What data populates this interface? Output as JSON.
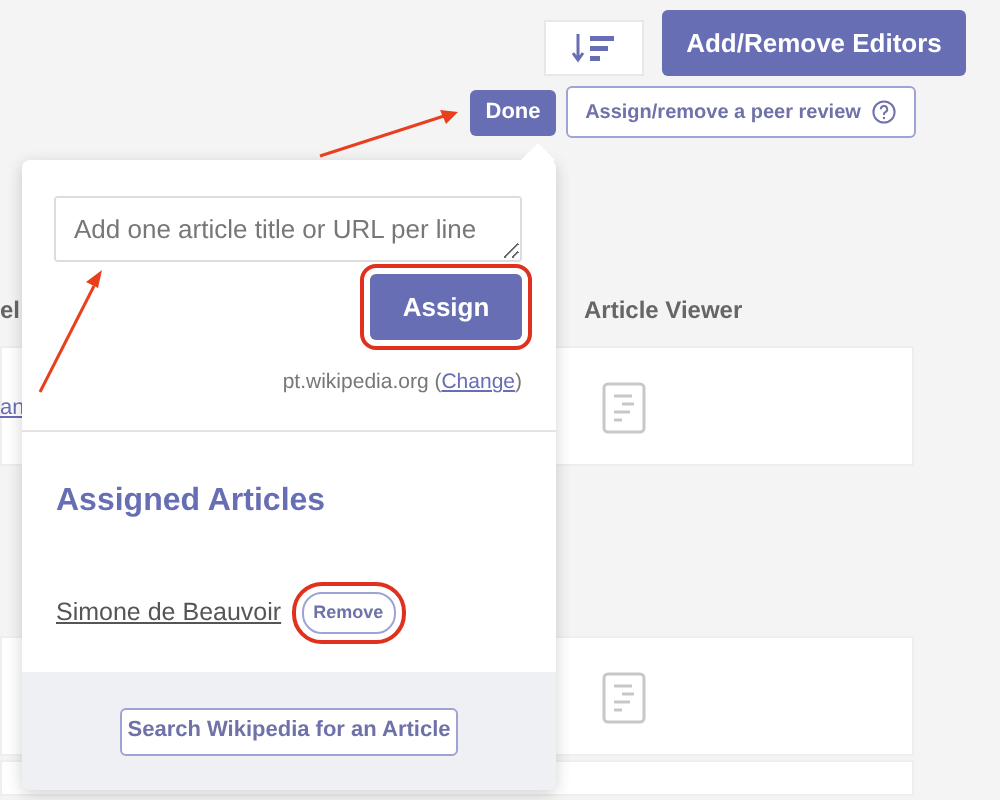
{
  "toolbar": {
    "editors_button": "Add/Remove Editors",
    "done_button": "Done",
    "peer_review_button": "Assign/remove a peer review"
  },
  "table": {
    "columns": [
      "el",
      "Article Viewer"
    ],
    "rows": [
      {
        "kind": "article",
        "link": "an"
      },
      {
        "kind": "article"
      },
      {
        "kind": "article"
      }
    ]
  },
  "popover": {
    "placeholder": "Add one article title or URL per line",
    "assign_button": {
      "label": "Assign",
      "highlighted": true
    },
    "wiki_note": {
      "prefix": "pt.wikipedia.org (",
      "link": "Change",
      "suffix": ")"
    },
    "heading": "Assigned Articles",
    "articles": [
      {
        "title": "Simone de Beauvoir",
        "remove_label": "Remove",
        "highlighted": true
      }
    ],
    "search_button": "Search Wikipedia for an Article"
  }
}
